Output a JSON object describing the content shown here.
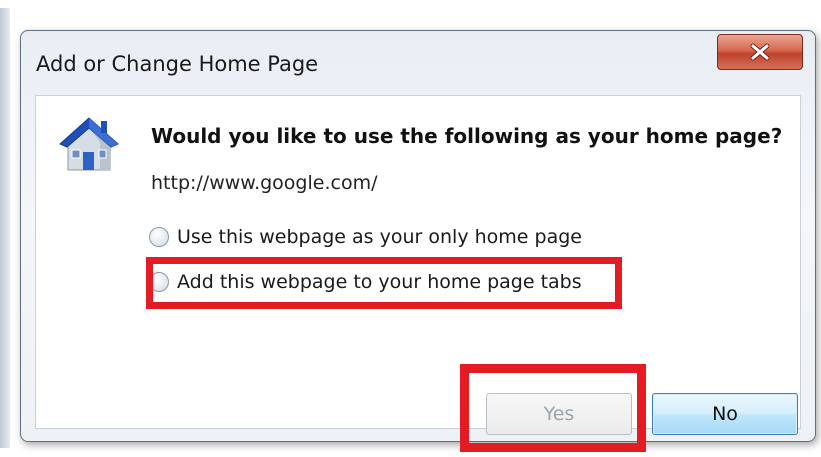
{
  "dialog": {
    "title": "Add or Change Home Page",
    "close_icon": "close-x-icon",
    "app_icon": "home-house-icon",
    "question": "Would you like to use the following as your home page?",
    "url": "http://www.google.com/",
    "options": [
      {
        "label": "Use this webpage as your only home page",
        "selected": false
      },
      {
        "label": "Add this webpage to your home page tabs",
        "selected": false,
        "highlighted": true
      }
    ],
    "buttons": {
      "yes_label": "Yes",
      "yes_enabled": false,
      "yes_highlighted": true,
      "no_label": "No"
    }
  },
  "colors": {
    "highlight": "#e51b24",
    "close_button": "#c9533a",
    "no_button": "#bee6fd"
  }
}
